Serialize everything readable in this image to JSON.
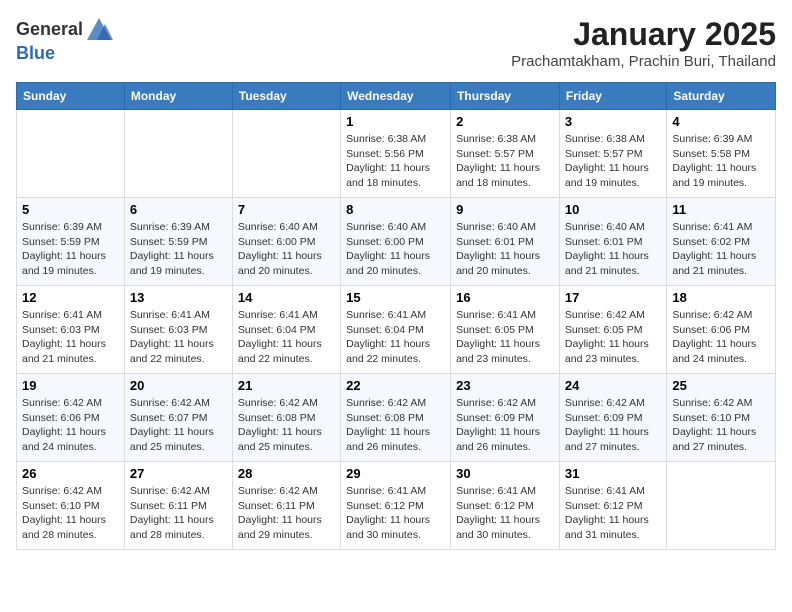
{
  "header": {
    "logo_line1": "General",
    "logo_line2": "Blue",
    "month_title": "January 2025",
    "subtitle": "Prachamtakham, Prachin Buri, Thailand"
  },
  "weekdays": [
    "Sunday",
    "Monday",
    "Tuesday",
    "Wednesday",
    "Thursday",
    "Friday",
    "Saturday"
  ],
  "weeks": [
    [
      {
        "day": "",
        "info": ""
      },
      {
        "day": "",
        "info": ""
      },
      {
        "day": "",
        "info": ""
      },
      {
        "day": "1",
        "info": "Sunrise: 6:38 AM\nSunset: 5:56 PM\nDaylight: 11 hours and 18 minutes."
      },
      {
        "day": "2",
        "info": "Sunrise: 6:38 AM\nSunset: 5:57 PM\nDaylight: 11 hours and 18 minutes."
      },
      {
        "day": "3",
        "info": "Sunrise: 6:38 AM\nSunset: 5:57 PM\nDaylight: 11 hours and 19 minutes."
      },
      {
        "day": "4",
        "info": "Sunrise: 6:39 AM\nSunset: 5:58 PM\nDaylight: 11 hours and 19 minutes."
      }
    ],
    [
      {
        "day": "5",
        "info": "Sunrise: 6:39 AM\nSunset: 5:59 PM\nDaylight: 11 hours and 19 minutes."
      },
      {
        "day": "6",
        "info": "Sunrise: 6:39 AM\nSunset: 5:59 PM\nDaylight: 11 hours and 19 minutes."
      },
      {
        "day": "7",
        "info": "Sunrise: 6:40 AM\nSunset: 6:00 PM\nDaylight: 11 hours and 20 minutes."
      },
      {
        "day": "8",
        "info": "Sunrise: 6:40 AM\nSunset: 6:00 PM\nDaylight: 11 hours and 20 minutes."
      },
      {
        "day": "9",
        "info": "Sunrise: 6:40 AM\nSunset: 6:01 PM\nDaylight: 11 hours and 20 minutes."
      },
      {
        "day": "10",
        "info": "Sunrise: 6:40 AM\nSunset: 6:01 PM\nDaylight: 11 hours and 21 minutes."
      },
      {
        "day": "11",
        "info": "Sunrise: 6:41 AM\nSunset: 6:02 PM\nDaylight: 11 hours and 21 minutes."
      }
    ],
    [
      {
        "day": "12",
        "info": "Sunrise: 6:41 AM\nSunset: 6:03 PM\nDaylight: 11 hours and 21 minutes."
      },
      {
        "day": "13",
        "info": "Sunrise: 6:41 AM\nSunset: 6:03 PM\nDaylight: 11 hours and 22 minutes."
      },
      {
        "day": "14",
        "info": "Sunrise: 6:41 AM\nSunset: 6:04 PM\nDaylight: 11 hours and 22 minutes."
      },
      {
        "day": "15",
        "info": "Sunrise: 6:41 AM\nSunset: 6:04 PM\nDaylight: 11 hours and 22 minutes."
      },
      {
        "day": "16",
        "info": "Sunrise: 6:41 AM\nSunset: 6:05 PM\nDaylight: 11 hours and 23 minutes."
      },
      {
        "day": "17",
        "info": "Sunrise: 6:42 AM\nSunset: 6:05 PM\nDaylight: 11 hours and 23 minutes."
      },
      {
        "day": "18",
        "info": "Sunrise: 6:42 AM\nSunset: 6:06 PM\nDaylight: 11 hours and 24 minutes."
      }
    ],
    [
      {
        "day": "19",
        "info": "Sunrise: 6:42 AM\nSunset: 6:06 PM\nDaylight: 11 hours and 24 minutes."
      },
      {
        "day": "20",
        "info": "Sunrise: 6:42 AM\nSunset: 6:07 PM\nDaylight: 11 hours and 25 minutes."
      },
      {
        "day": "21",
        "info": "Sunrise: 6:42 AM\nSunset: 6:08 PM\nDaylight: 11 hours and 25 minutes."
      },
      {
        "day": "22",
        "info": "Sunrise: 6:42 AM\nSunset: 6:08 PM\nDaylight: 11 hours and 26 minutes."
      },
      {
        "day": "23",
        "info": "Sunrise: 6:42 AM\nSunset: 6:09 PM\nDaylight: 11 hours and 26 minutes."
      },
      {
        "day": "24",
        "info": "Sunrise: 6:42 AM\nSunset: 6:09 PM\nDaylight: 11 hours and 27 minutes."
      },
      {
        "day": "25",
        "info": "Sunrise: 6:42 AM\nSunset: 6:10 PM\nDaylight: 11 hours and 27 minutes."
      }
    ],
    [
      {
        "day": "26",
        "info": "Sunrise: 6:42 AM\nSunset: 6:10 PM\nDaylight: 11 hours and 28 minutes."
      },
      {
        "day": "27",
        "info": "Sunrise: 6:42 AM\nSunset: 6:11 PM\nDaylight: 11 hours and 28 minutes."
      },
      {
        "day": "28",
        "info": "Sunrise: 6:42 AM\nSunset: 6:11 PM\nDaylight: 11 hours and 29 minutes."
      },
      {
        "day": "29",
        "info": "Sunrise: 6:41 AM\nSunset: 6:12 PM\nDaylight: 11 hours and 30 minutes."
      },
      {
        "day": "30",
        "info": "Sunrise: 6:41 AM\nSunset: 6:12 PM\nDaylight: 11 hours and 30 minutes."
      },
      {
        "day": "31",
        "info": "Sunrise: 6:41 AM\nSunset: 6:12 PM\nDaylight: 11 hours and 31 minutes."
      },
      {
        "day": "",
        "info": ""
      }
    ]
  ]
}
